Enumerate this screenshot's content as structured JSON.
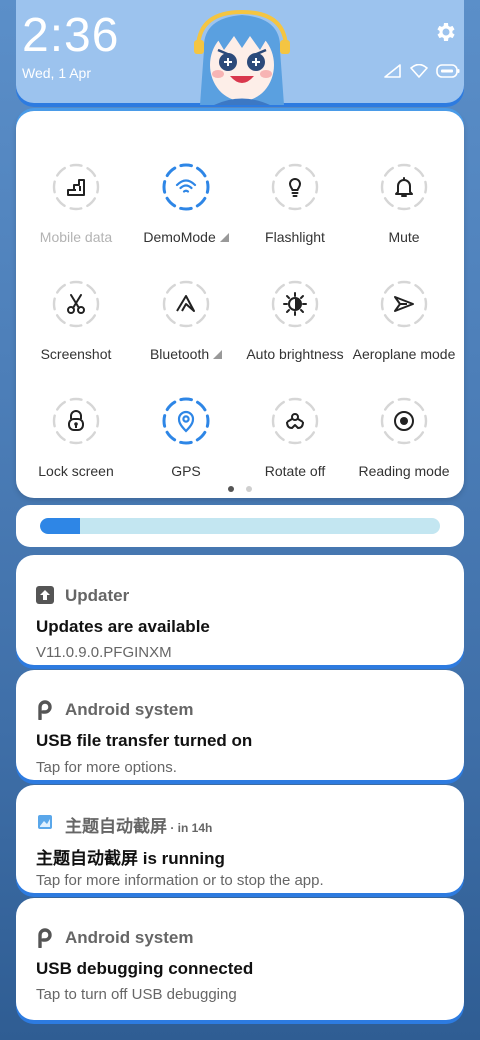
{
  "status": {
    "time": "2:36",
    "date": "Wed, 1 Apr",
    "icons": [
      "signal-icon",
      "wifi-icon",
      "battery-icon"
    ]
  },
  "quick_settings": {
    "tiles": [
      {
        "label": "Mobile data",
        "icon": "mobile-data-icon",
        "active": false,
        "dim": true,
        "arrow": false
      },
      {
        "label": "DemoMode",
        "icon": "wifi-icon",
        "active": true,
        "dim": false,
        "arrow": true
      },
      {
        "label": "Flashlight",
        "icon": "flashlight-icon",
        "active": false,
        "dim": false,
        "arrow": false
      },
      {
        "label": "Mute",
        "icon": "bell-icon",
        "active": false,
        "dim": false,
        "arrow": false
      },
      {
        "label": "Screenshot",
        "icon": "scissors-icon",
        "active": false,
        "dim": false,
        "arrow": false
      },
      {
        "label": "Bluetooth",
        "icon": "bluetooth-icon",
        "active": false,
        "dim": false,
        "arrow": true
      },
      {
        "label": "Auto brightness",
        "icon": "auto-brightness-icon",
        "active": false,
        "dim": false,
        "arrow": false
      },
      {
        "label": "Aeroplane mode",
        "icon": "aeroplane-icon",
        "active": false,
        "dim": false,
        "arrow": false
      },
      {
        "label": "Lock screen",
        "icon": "lock-icon",
        "active": false,
        "dim": false,
        "arrow": false
      },
      {
        "label": "GPS",
        "icon": "location-icon",
        "active": true,
        "dim": false,
        "arrow": false
      },
      {
        "label": "Rotate off",
        "icon": "rotate-icon",
        "active": false,
        "dim": false,
        "arrow": false
      },
      {
        "label": "Reading mode",
        "icon": "reading-mode-icon",
        "active": false,
        "dim": false,
        "arrow": false
      }
    ],
    "page_count": 2,
    "current_page": 1
  },
  "brightness": {
    "level": 0.1
  },
  "notifications": [
    {
      "app": "Updater",
      "app_sub": "",
      "icon": "updater-icon",
      "title": "Updates are available",
      "text": "V11.0.9.0.PFGINXM"
    },
    {
      "app": "Android system",
      "app_sub": "",
      "icon": "android-system-icon",
      "title": "USB file transfer turned on",
      "text": "Tap for more options."
    },
    {
      "app": "主题自动截屏",
      "app_sub": " · in 14h",
      "icon": "theme-app-icon",
      "title": "主题自动截屏 is running",
      "text": "Tap for more information or to stop the app."
    },
    {
      "app": "Android system",
      "app_sub": "",
      "icon": "android-system-icon",
      "title": "USB debugging connected",
      "text": "Tap to turn off USB debugging"
    }
  ],
  "colors": {
    "accent": "#2e86e6",
    "header_bg": "#9cc3ee",
    "brightness_track": "#c3e6f1"
  }
}
